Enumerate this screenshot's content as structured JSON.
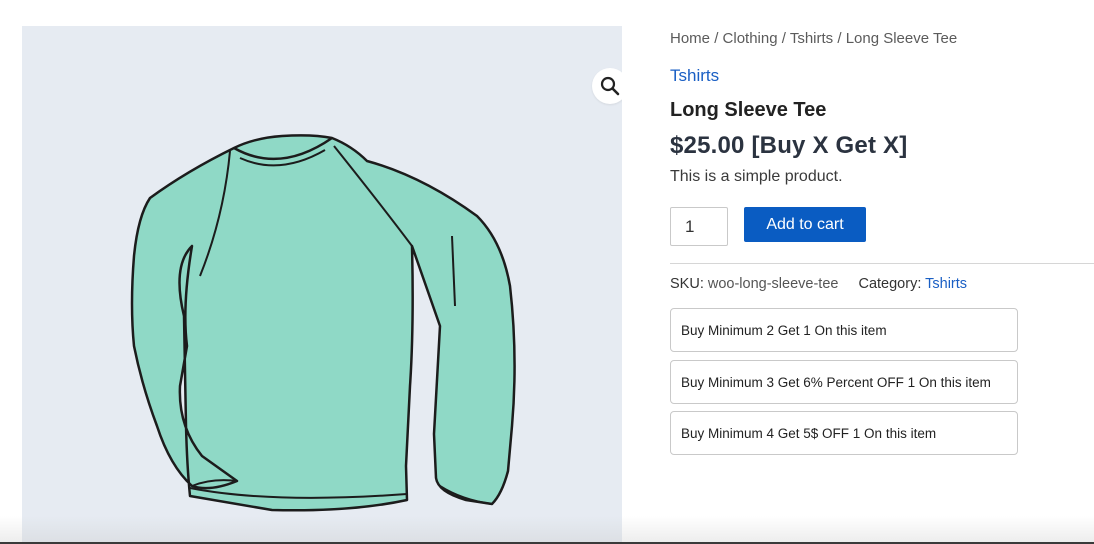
{
  "breadcrumb": {
    "home": "Home",
    "clothing": "Clothing",
    "tshirts": "Tshirts",
    "current": "Long Sleeve Tee",
    "separator": "/"
  },
  "product": {
    "category_link": "Tshirts",
    "title": "Long Sleeve Tee",
    "price": "$25.00 [Buy X Get X]",
    "description": "This is a simple product.",
    "quantity": "1",
    "add_to_cart_label": "Add to cart",
    "sku_label": "SKU:",
    "sku_value": "woo-long-sleeve-tee",
    "category_label": "Category:",
    "category_value": "Tshirts"
  },
  "offers": [
    "Buy Minimum 2 Get 1 On this item",
    "Buy Minimum 3 Get 6% Percent OFF 1 On this item",
    "Buy Minimum 4 Get 5$ OFF 1 On this item"
  ],
  "icons": {
    "zoom": "magnifier-icon"
  },
  "colors": {
    "accent": "#0a5cc2",
    "link": "#1a5fc4",
    "image_background": "#e6ebf2",
    "garment": "#8fd9c6"
  }
}
